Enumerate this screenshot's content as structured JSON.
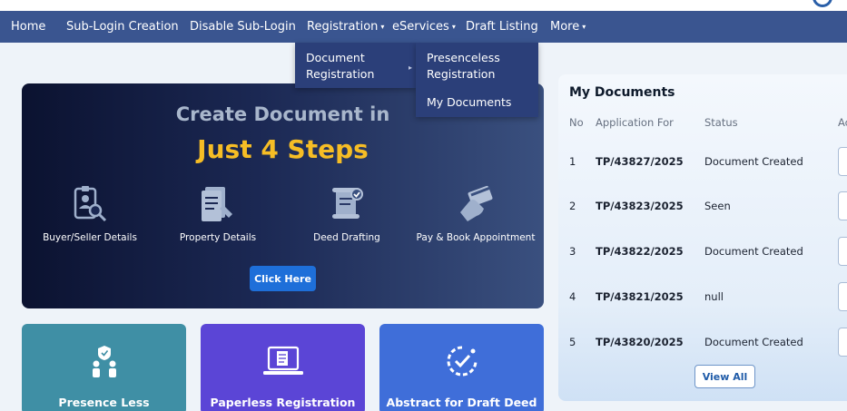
{
  "nav": {
    "items": [
      {
        "label": "Home"
      },
      {
        "label": "Sub-Login Creation"
      },
      {
        "label": "Disable Sub-Login"
      },
      {
        "label": "Registration",
        "caret": "▾"
      },
      {
        "label": "eServices",
        "caret": "▾"
      },
      {
        "label": "Draft Listing"
      },
      {
        "label": "More",
        "caret": "▾"
      }
    ]
  },
  "dropdown": {
    "level1": [
      "Document",
      "Registration"
    ],
    "level2": [
      {
        "line1": "Presenceless",
        "line2": "Registration"
      },
      {
        "line1": "My Documents"
      }
    ]
  },
  "hero": {
    "title": "Create Document in",
    "subtitle": "Just 4 Steps",
    "steps": [
      {
        "label": "Buyer/Seller Details",
        "icon": "id-card-search-icon"
      },
      {
        "label": "Property Details",
        "icon": "document-edit-icon"
      },
      {
        "label": "Deed Drafting",
        "icon": "scroll-check-icon"
      },
      {
        "label": "Pay & Book Appointment",
        "icon": "credit-card-hand-icon"
      }
    ],
    "button": "Click Here"
  },
  "cards": [
    {
      "label": "Presence Less",
      "color": "#3f8fa5",
      "icon": "people-shield-icon"
    },
    {
      "label": "Paperless Registration",
      "color": "#5b45d6",
      "icon": "laptop-document-icon"
    },
    {
      "label": "Abstract for Draft Deed",
      "color": "#3f6ed9",
      "icon": "timer-check-icon"
    }
  ],
  "my_documents": {
    "title": "My Documents",
    "columns": [
      "No",
      "Application For",
      "Status",
      "Ac"
    ],
    "rows": [
      {
        "no": "1",
        "app": "TP/43827/2025",
        "status": "Document Created"
      },
      {
        "no": "2",
        "app": "TP/43823/2025",
        "status": "Seen"
      },
      {
        "no": "3",
        "app": "TP/43822/2025",
        "status": "Document Created"
      },
      {
        "no": "4",
        "app": "TP/43821/2025",
        "status": "null"
      },
      {
        "no": "5",
        "app": "TP/43820/2025",
        "status": "Document Created"
      }
    ],
    "view_all": "View All"
  }
}
